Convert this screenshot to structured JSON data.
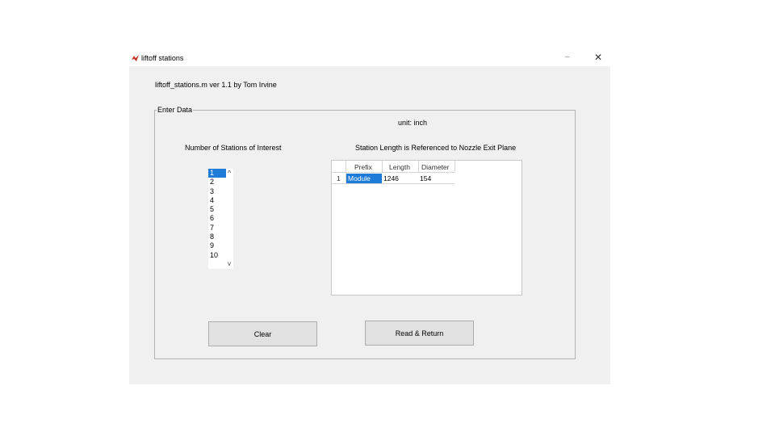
{
  "window": {
    "title": "liftoff stations",
    "minimize_glyph": "–",
    "close_glyph": "✕"
  },
  "header": {
    "text": "liftoff_stations.m  ver 1.1  by Tom Irvine"
  },
  "panel": {
    "title": "Enter Data",
    "unit_label": "unit: inch",
    "stations_label": "Number of Stations of Interest",
    "reference_label": "Station Length is Referenced to Nozzle Exit Plane"
  },
  "stations_list": {
    "items": [
      "1",
      "2",
      "3",
      "4",
      "5",
      "6",
      "7",
      "8",
      "9",
      "10"
    ],
    "selected": "1",
    "scroll_up_glyph": "^",
    "scroll_down_glyph": "v"
  },
  "table": {
    "columns": [
      "Prefix",
      "Length",
      "Diameter"
    ],
    "rows": [
      {
        "row_number": "1",
        "prefix": "Module",
        "length": "1246",
        "diameter": "154"
      }
    ]
  },
  "buttons": {
    "clear": "Clear",
    "read_return": "Read & Return"
  },
  "colors": {
    "selection": "#1e7bd7",
    "client_background": "#f0f0f0",
    "button_face": "#e1e1e1"
  }
}
